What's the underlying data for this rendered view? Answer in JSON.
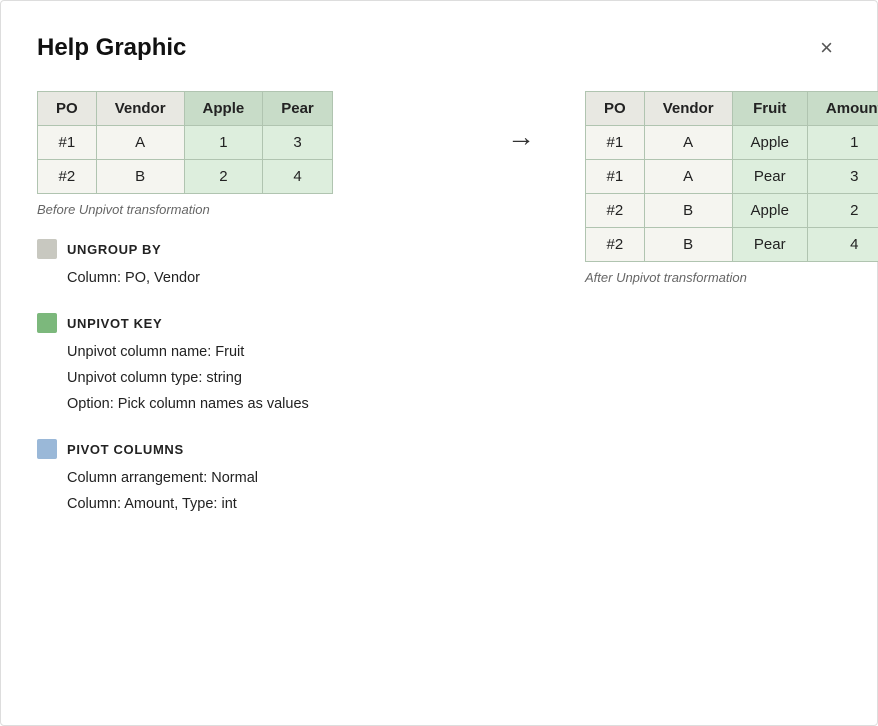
{
  "dialog": {
    "title": "Help Graphic",
    "close_label": "×"
  },
  "before_table": {
    "caption": "Before Unpivot transformation",
    "headers": [
      "PO",
      "Vendor",
      "Apple",
      "Pear"
    ],
    "rows": [
      [
        "#1",
        "A",
        "1",
        "3"
      ],
      [
        "#2",
        "B",
        "2",
        "4"
      ]
    ]
  },
  "after_table": {
    "caption": "After Unpivot transformation",
    "headers": [
      "PO",
      "Vendor",
      "Fruit",
      "Amount"
    ],
    "rows": [
      [
        "#1",
        "A",
        "Apple",
        "1"
      ],
      [
        "#1",
        "A",
        "Pear",
        "3"
      ],
      [
        "#2",
        "B",
        "Apple",
        "2"
      ],
      [
        "#2",
        "B",
        "Pear",
        "4"
      ]
    ]
  },
  "legend": {
    "ungroup": {
      "label": "UNGROUP BY",
      "lines": [
        "Column: PO, Vendor"
      ]
    },
    "unpivot_key": {
      "label": "UNPIVOT KEY",
      "lines": [
        "Unpivot column name: Fruit",
        "Unpivot column type: string",
        "Option: Pick column names as values"
      ]
    },
    "pivot_columns": {
      "label": "PIVOT COLUMNS",
      "lines": [
        "Column arrangement: Normal",
        "Column: Amount, Type: int"
      ]
    }
  }
}
